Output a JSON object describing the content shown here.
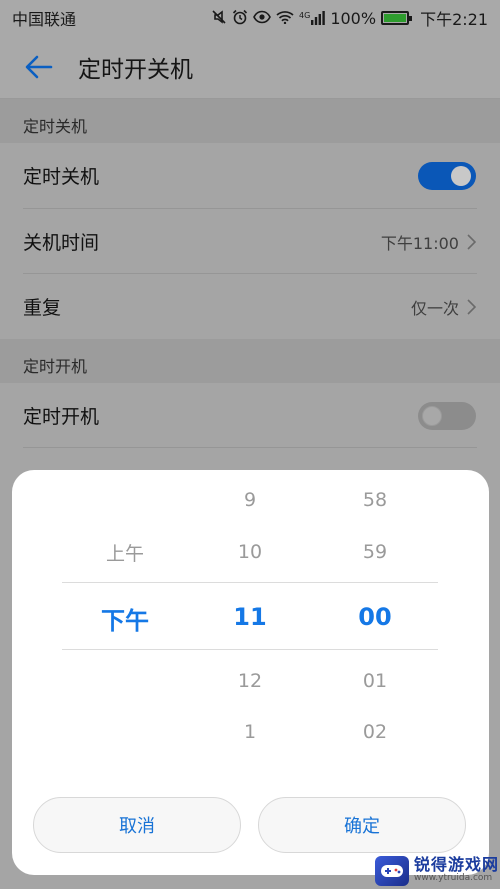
{
  "status_bar": {
    "carrier": "中国联通",
    "network": "4G",
    "battery_percent": "100%",
    "time": "下午2:21",
    "icons": [
      "mute-icon",
      "alarm-icon",
      "eye-icon",
      "wifi-icon",
      "signal-icon",
      "battery-icon"
    ]
  },
  "app_bar": {
    "back_icon": "arrow-left-icon",
    "title": "定时开关机"
  },
  "sections": {
    "shutdown": {
      "header": "定时关机",
      "toggle_label": "定时关机",
      "toggle_on": true,
      "time_label": "关机时间",
      "time_value": "下午11:00",
      "repeat_label": "重复",
      "repeat_value": "仅一次"
    },
    "startup": {
      "header": "定时开机",
      "toggle_label": "定时开机",
      "toggle_on": false
    }
  },
  "picker": {
    "period": {
      "items": [
        "上午",
        "下午"
      ],
      "selected": "下午"
    },
    "hour": {
      "items": [
        "9",
        "10",
        "11",
        "12",
        "1"
      ],
      "selected": "11"
    },
    "minute": {
      "items": [
        "58",
        "59",
        "00",
        "01",
        "02"
      ],
      "selected": "00"
    },
    "cancel_label": "取消",
    "confirm_label": "确定"
  },
  "watermark": {
    "name": "锐得游戏网",
    "url": "www.ytruida.com"
  },
  "colors": {
    "accent": "#1578e6",
    "toggle_on": "#0a57b7",
    "dim_background": "#a5a5a5"
  }
}
